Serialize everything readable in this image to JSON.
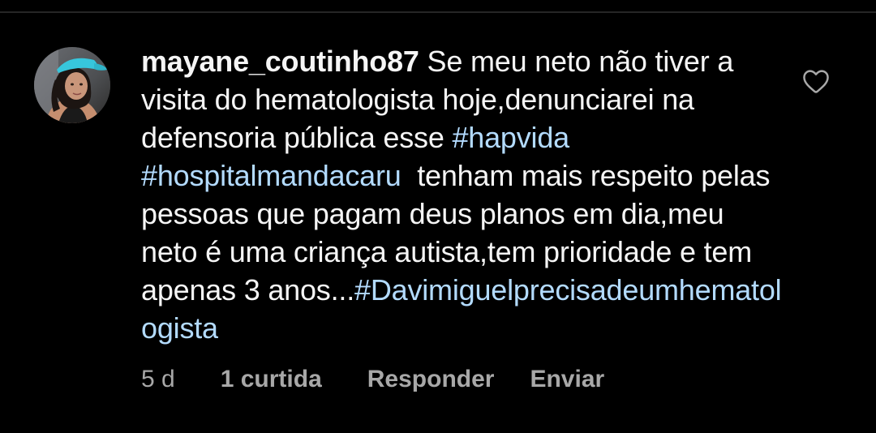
{
  "comment": {
    "username": "mayane_coutinho87",
    "text_parts": [
      {
        "type": "text",
        "value": " Se meu neto não tiver a visita do hematologista hoje,denunciarei na defensoria pública esse "
      },
      {
        "type": "hashtag",
        "value": "#hapvida"
      },
      {
        "type": "text",
        "value": " "
      },
      {
        "type": "hashtag",
        "value": "#hospitalmandacaru"
      },
      {
        "type": "text",
        "value": "  tenham mais respeito pelas pessoas que pagam deus planos em dia,meu neto é uma criança autista,tem prioridade e tem apenas 3 anos..."
      },
      {
        "type": "hashtag",
        "value": "#Davimiguelprecisadeumhematologista"
      }
    ],
    "time_ago": "5 d",
    "likes_label": "1 curtida",
    "reply_label": "Responder",
    "send_label": "Enviar"
  },
  "icons": {
    "like": "heart-outline-icon"
  },
  "colors": {
    "background": "#000000",
    "text": "#f5f5f5",
    "hashtag": "#e0f1ff",
    "meta": "#a8a8a8",
    "divider": "#262626"
  }
}
